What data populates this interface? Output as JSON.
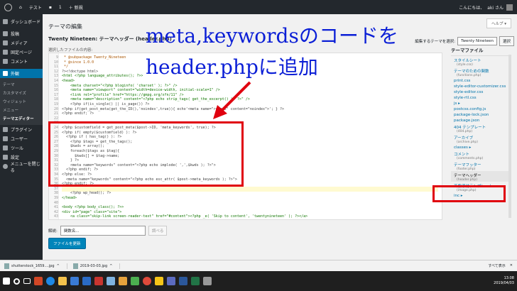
{
  "adminbar": {
    "site_name": "テスト",
    "comments_count": "1",
    "new_label": "＋ 新規",
    "greeting": "こんにちは、",
    "user": "aki さん"
  },
  "sidebar": {
    "dashboard": "ダッシュボード",
    "posts": "投稿",
    "media": "メディア",
    "pages": "固定ページ",
    "comments": "コメント",
    "appearance": "外観",
    "appearance_sub": [
      "テーマ",
      "カスタマイズ",
      "ウィジェット",
      "メニュー",
      "テーマエディター"
    ],
    "plugins": "プラグイン",
    "users": "ユーザー",
    "tools": "ツール",
    "settings": "設定",
    "collapse": "メニューを閉じる"
  },
  "content": {
    "page_title": "テーマの編集",
    "help": "ヘルプ ▾",
    "file_title": "Twenty Nineteen: テーマヘッダー (header.php)",
    "file_label": "選択したファイルの内容:",
    "theme_select_label": "編集するテーマを選択:",
    "theme_selected": "Twenty Nineteen",
    "theme_select_button": "選択"
  },
  "overlay": {
    "title_line1": "meta,keywordsのコードを",
    "title_line2": "header.phpに追加"
  },
  "code": {
    "lines": [
      {
        "n": "9",
        "t": " * @subpackage Twenty_Nineteen",
        "c": "cmt"
      },
      {
        "n": "10",
        "t": " * @since 1.0.0",
        "c": "cmt"
      },
      {
        "n": "11",
        "t": " */",
        "c": "cmt"
      },
      {
        "n": "12",
        "t": "?><!doctype html>",
        "c": ""
      },
      {
        "n": "13",
        "t": "<html <?php language_attributes(); ?>>",
        "c": "tag"
      },
      {
        "n": "14",
        "t": "<head>",
        "c": "tag"
      },
      {
        "n": "15",
        "t": "    <meta charset=\"<?php bloginfo( 'charset' ); ?>\" />",
        "c": "tag"
      },
      {
        "n": "16",
        "t": "    <meta name=\"viewport\" content=\"width=device-width, initial-scale=1\" />",
        "c": "tag"
      },
      {
        "n": "17",
        "t": "    <link rel=\"profile\" href=\"https://gmpg.org/xfn/11\" />",
        "c": "tag"
      },
      {
        "n": "18",
        "t": "    <meta name=\"description\" content=\"<?php echo strip_tags( get_the_excerpt() ); ?>\" />",
        "c": "tag"
      },
      {
        "n": "19",
        "t": "    <?php if(is_single() || is_page()) ?>",
        "c": ""
      },
      {
        "n": "20",
        "t": "<?php if(get_post_meta(get_the_ID(),'noindex',true)){ echo'<meta name=\"robots\" content=\"noindex\">'; } ?>",
        "c": ""
      },
      {
        "n": "21",
        "t": "<?php endif; ?>",
        "c": ""
      },
      {
        "n": "22",
        "t": "",
        "c": ""
      },
      {
        "n": "23",
        "t": "",
        "c": ""
      },
      {
        "n": "24",
        "t": "<?php $customfield = get_post_meta($post->ID, 'meta_keywords', true); ?>",
        "c": ""
      },
      {
        "n": "25",
        "t": "<?php if( empty($customfield) ): ?>",
        "c": ""
      },
      {
        "n": "26",
        "t": "  <?php if ( has_tag() ): ?>",
        "c": ""
      },
      {
        "n": "27",
        "t": "    <?php $tags = get_the_tags();",
        "c": ""
      },
      {
        "n": "28",
        "t": "    $kwds = array();",
        "c": ""
      },
      {
        "n": "29",
        "t": "    foreach($tags as $tag){",
        "c": ""
      },
      {
        "n": "30",
        "t": "      $kwds[] = $tag->name;",
        "c": ""
      },
      {
        "n": "31",
        "t": "    } ?>",
        "c": ""
      },
      {
        "n": "32",
        "t": "    <meta name=\"keywords\" content=\"<?php echo implode( ',',$kwds ); ?>\">",
        "c": ""
      },
      {
        "n": "33",
        "t": "  <?php endif; ?>",
        "c": ""
      },
      {
        "n": "34",
        "t": "<?php else: ?>",
        "c": ""
      },
      {
        "n": "35",
        "t": "  <meta name=\"keywords\" content=\"<?php echo esc_attr( $post->meta_keywords ); ?>\">",
        "c": ""
      },
      {
        "n": "36",
        "t": "<?php endif; ?>",
        "c": ""
      },
      {
        "n": "37",
        "t": "",
        "c": "hl"
      },
      {
        "n": "38",
        "t": "    <?php wp_head(); ?>",
        "c": ""
      },
      {
        "n": "39",
        "t": "</head>",
        "c": "tag"
      },
      {
        "n": "40",
        "t": "",
        "c": ""
      },
      {
        "n": "41",
        "t": "<body <?php body_class(); ?>>",
        "c": "tag"
      },
      {
        "n": "42",
        "t": "<div id=\"page\" class=\"site\">",
        "c": "tag"
      },
      {
        "n": "43",
        "t": "    <a class=\"skip-link screen-reader-text\" href=\"#content\"><?php _e( 'Skip to content', 'twentynineteen' ); ?></a>",
        "c": "tag"
      }
    ]
  },
  "theme_files": {
    "heading": "テーマファイル",
    "items": [
      {
        "label": "スタイルシート",
        "sub": "(style.css)"
      },
      {
        "label": "テーマのための関数",
        "sub": "(functions.php)"
      },
      {
        "label": "print.css",
        "sub": ""
      },
      {
        "label": "style-editor-customizer.css",
        "sub": ""
      },
      {
        "label": "style-editor.css",
        "sub": ""
      },
      {
        "label": "style-rtl.css",
        "sub": ""
      },
      {
        "label": "js ▸",
        "sub": ""
      },
      {
        "label": "postcss.config.js",
        "sub": ""
      },
      {
        "label": "package-lock.json",
        "sub": ""
      },
      {
        "label": "package.json",
        "sub": ""
      },
      {
        "label": "404 テンプレート",
        "sub": "(404.php)"
      },
      {
        "label": "アーカイブ",
        "sub": "(archive.php)"
      },
      {
        "label": "classes ▸",
        "sub": ""
      },
      {
        "label": "コメント",
        "sub": "(comments.php)"
      },
      {
        "label": "テーマフッター",
        "sub": "(footer.php)"
      },
      {
        "label": "テーマヘッダー",
        "sub": "(header.php)"
      },
      {
        "label": "画像添付テンプレート",
        "sub": "(image.php)"
      },
      {
        "label": "inc ▸",
        "sub": ""
      }
    ]
  },
  "docs": {
    "label": "解説:",
    "placeholder": "関数名...",
    "button": "調べる"
  },
  "update_button": "ファイルを更新",
  "downloads": {
    "file1": "shutterstock_1659....jpg",
    "file2": "2019-03-03.jpg",
    "show_all": "すべて表示",
    "close": "✕"
  },
  "clock": {
    "time": "13:08",
    "date": "2019/04/03"
  }
}
